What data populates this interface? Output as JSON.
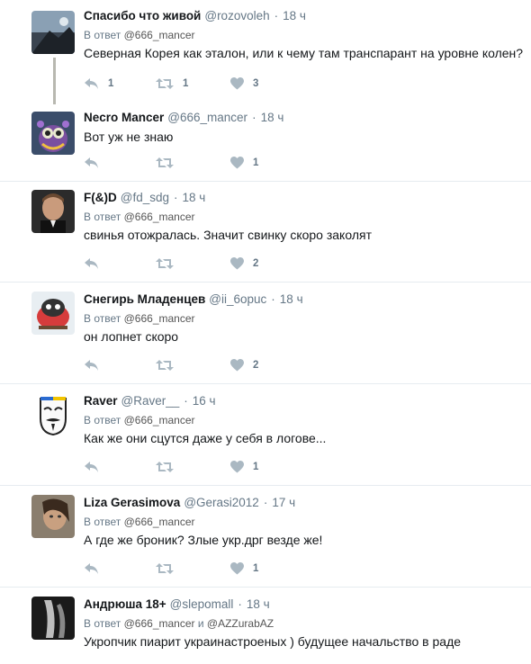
{
  "reply_prefix": "В ответ",
  "and_word": "и",
  "tweets": [
    {
      "name": "Спасибо что живой",
      "handle": "@rozovoleh",
      "time": "18 ч",
      "reply_to": "@666_mancer",
      "text": "Северная Корея как эталон, или к чему там транспарант на уровне колен?",
      "replies": "1",
      "retweets": "1",
      "likes": "3"
    },
    {
      "name": "Necro Mancer",
      "handle": "@666_mancer",
      "time": "18 ч",
      "text": "Вот уж не знаю",
      "likes": "1"
    },
    {
      "name": "F(&)D",
      "handle": "@fd_sdg",
      "time": "18 ч",
      "reply_to": "@666_mancer",
      "text": "свинья отожралась. Значит свинку скоро заколят",
      "likes": "2"
    },
    {
      "name": "Снегирь Младенцев",
      "handle": "@ii_6opuc",
      "time": "18 ч",
      "reply_to": "@666_mancer",
      "text": "он лопнет скоро",
      "likes": "2"
    },
    {
      "name": "Raver",
      "handle": "@Raver__",
      "time": "16 ч",
      "reply_to": "@666_mancer",
      "text": "Как же они сцутся даже у себя в логове...",
      "likes": "1"
    },
    {
      "name": "Liza Gerasimova",
      "handle": "@Gerasi2012",
      "time": "17 ч",
      "reply_to": "@666_mancer",
      "text": "А где же броник?  Злые укр.дрг везде же!",
      "likes": "1"
    },
    {
      "name": "Андрюша 18+",
      "handle": "@slepomall",
      "time": "18 ч",
      "reply_to": "@666_mancer",
      "reply_to_2": "@AZZurabAZ",
      "text": "Укропчик пиарит украинастроеных ) будущее начальство в раде"
    }
  ]
}
